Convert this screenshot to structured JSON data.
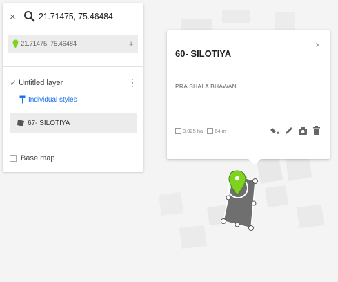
{
  "search": {
    "close_symbol": "×",
    "query": "21.71475, 75.46484"
  },
  "result": {
    "text": "21.71475, 75.46484",
    "action_symbol": "+"
  },
  "layer": {
    "name": "Untitled layer",
    "styles_link": "Individual styles",
    "feature": "67- SILOTIYA"
  },
  "basemap": {
    "label": "Base map"
  },
  "popup": {
    "title": "60- SILOTIYA",
    "close_symbol": "×",
    "description": "PRA SHALA BHAWAN",
    "area": "0.025 ha",
    "perimeter": "64 m"
  },
  "colors": {
    "accent": "#1a73e8",
    "pin": "#7ed321",
    "polygon": "#6f6f6f"
  },
  "icons": [
    "search-icon",
    "location-pin-icon",
    "paint-roller-icon",
    "polygon-icon",
    "style-icon",
    "edit-icon",
    "camera-icon",
    "delete-icon"
  ]
}
